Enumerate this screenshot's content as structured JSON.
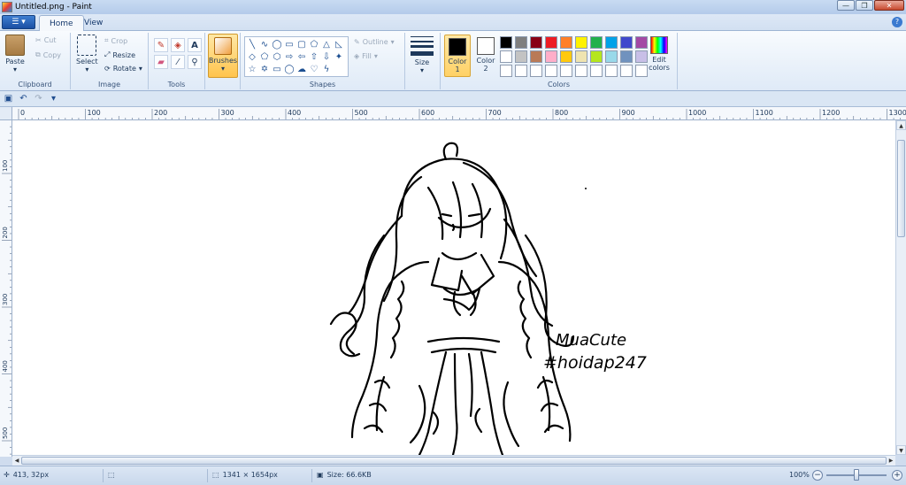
{
  "window": {
    "title": "Untitled.png - Paint"
  },
  "window_buttons": {
    "minimize": "—",
    "restore": "❐",
    "close": "✕"
  },
  "tabs": {
    "home": "Home",
    "view": "View"
  },
  "clipboard": {
    "paste": "Paste",
    "cut": "Cut",
    "copy": "Copy",
    "label": "Clipboard"
  },
  "image": {
    "select": "Select",
    "crop": "Crop",
    "resize": "Resize",
    "rotate": "Rotate",
    "label": "Image"
  },
  "tools": {
    "label": "Tools"
  },
  "brushes": {
    "label": "Brushes"
  },
  "shapes": {
    "label": "Shapes",
    "outline": "Outline",
    "fill": "Fill"
  },
  "size": {
    "label": "Size"
  },
  "colors": {
    "color1_label": "Color\n1",
    "color2_label": "Color\n2",
    "edit_colors": "Edit colors",
    "label": "Colors",
    "color1": "#000000",
    "color2": "#ffffff",
    "palette": [
      "#000000",
      "#7f7f7f",
      "#880015",
      "#ed1c24",
      "#ff7f27",
      "#fff200",
      "#22b14c",
      "#00a2e8",
      "#3f48cc",
      "#a349a4",
      "#ffffff",
      "#c3c3c3",
      "#b97a57",
      "#ffaec9",
      "#ffc90e",
      "#efe4b0",
      "#b5e61d",
      "#99d9ea",
      "#7092be",
      "#c8bfe7",
      "#ffffff",
      "#ffffff",
      "#ffffff",
      "#ffffff",
      "#ffffff",
      "#ffffff",
      "#ffffff",
      "#ffffff",
      "#ffffff",
      "#ffffff"
    ]
  },
  "ruler": {
    "h_labels": [
      "0",
      "100",
      "200",
      "300",
      "400",
      "500",
      "600",
      "700",
      "800",
      "900",
      "1000",
      "1100",
      "1200",
      "1300"
    ],
    "v_labels": [
      "100",
      "200",
      "300",
      "400",
      "500"
    ]
  },
  "canvas": {
    "signature_line1": "MuaCute",
    "signature_line2": "#hoidap247"
  },
  "status": {
    "cursor": "413, 32px",
    "dimensions": "1341 × 1654px",
    "size": "Size: 66.6KB",
    "zoom": "100%"
  }
}
